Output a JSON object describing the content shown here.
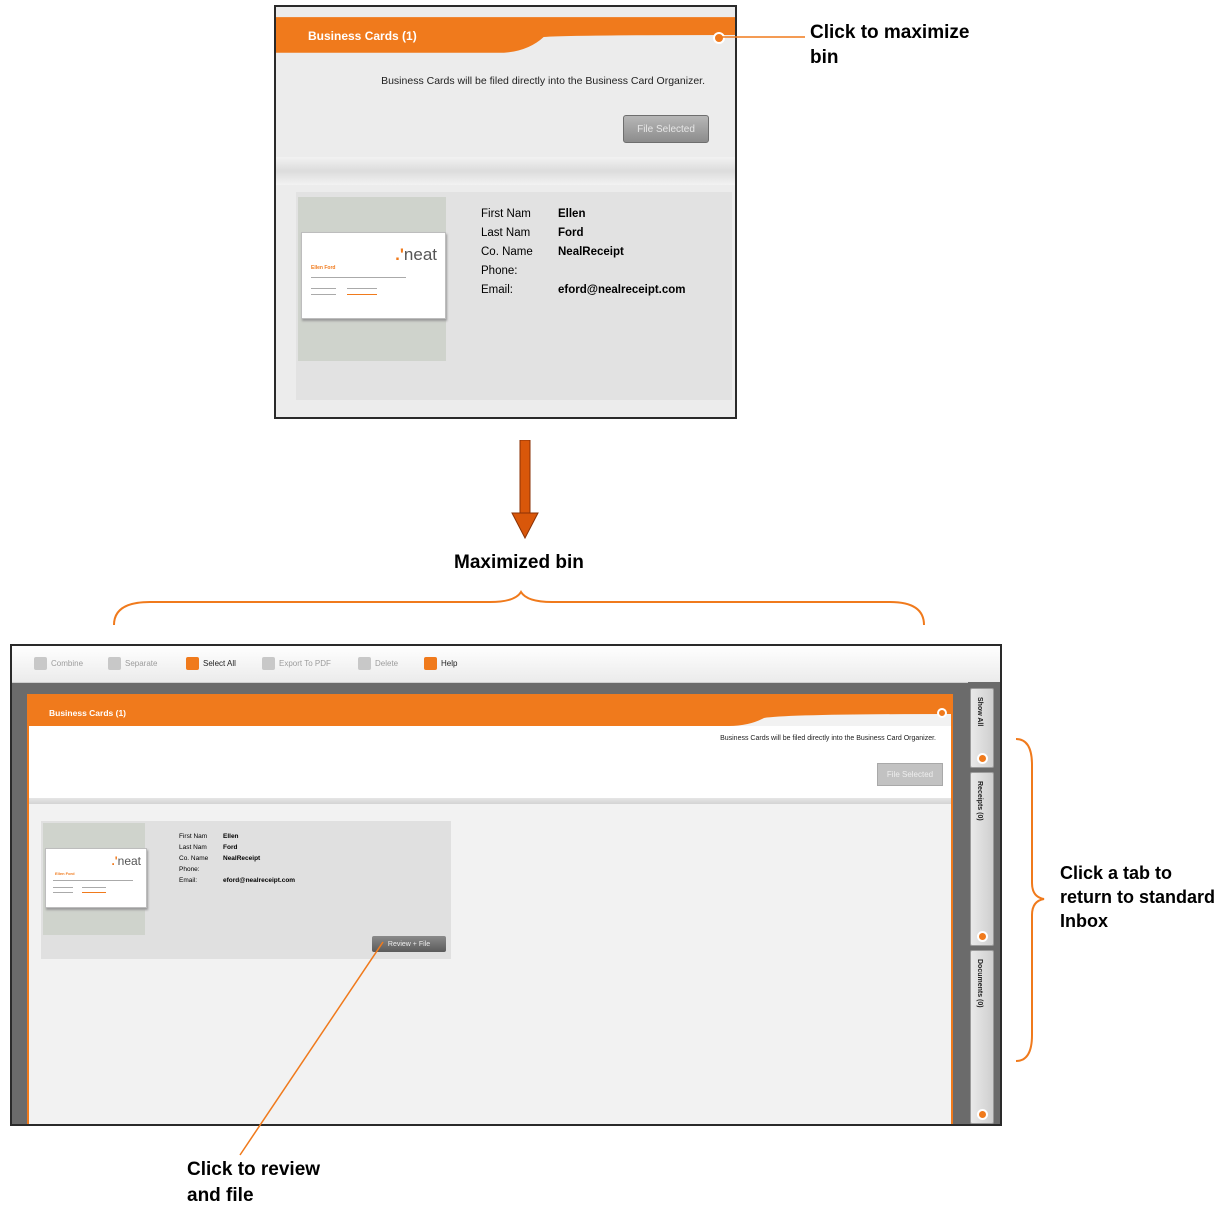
{
  "top_bin": {
    "title": "Business Cards (1)",
    "note": "Business Cards will be filed directly into the Business Card Organizer.",
    "file_button": "File Selected",
    "fields": [
      "First Nam",
      "Last Nam",
      "Co. Name",
      "Phone:",
      "Email:"
    ],
    "values": [
      "Ellen",
      "Ford",
      "NealReceipt",
      "",
      "eford@nealreceipt.com"
    ]
  },
  "card": {
    "logo": "neat",
    "name": "Ellen Ford"
  },
  "callouts": {
    "maximize": "Click to maximize bin",
    "maximized": "Maximized bin",
    "tab_return": "Click a tab to return to standard Inbox",
    "review": "Click to review and file"
  },
  "toolbar": {
    "items": [
      {
        "label": "Combine",
        "active": false
      },
      {
        "label": "Separate",
        "active": false
      },
      {
        "label": "Select All",
        "active": true
      },
      {
        "label": "Export To PDF",
        "active": false
      },
      {
        "label": "Delete",
        "active": false
      },
      {
        "label": "Help",
        "active": true
      }
    ]
  },
  "bottom_bin": {
    "title": "Business Cards (1)",
    "note": "Business Cards will be filed directly into the Business Card Organizer.",
    "file_button": "File Selected",
    "fields": [
      "First Nam",
      "Last Nam",
      "Co. Name",
      "Phone:",
      "Email:"
    ],
    "values": [
      "Ellen",
      "Ford",
      "NealReceipt",
      "",
      "eford@nealreceipt.com"
    ],
    "review_button": "Review + File"
  },
  "side_tabs": [
    "Show All",
    "Receipts (0)",
    "Documents (0)"
  ],
  "colors": {
    "accent": "#f07a1c",
    "panel_gray": "#6b6b6b",
    "body_gray": "#ececec"
  }
}
